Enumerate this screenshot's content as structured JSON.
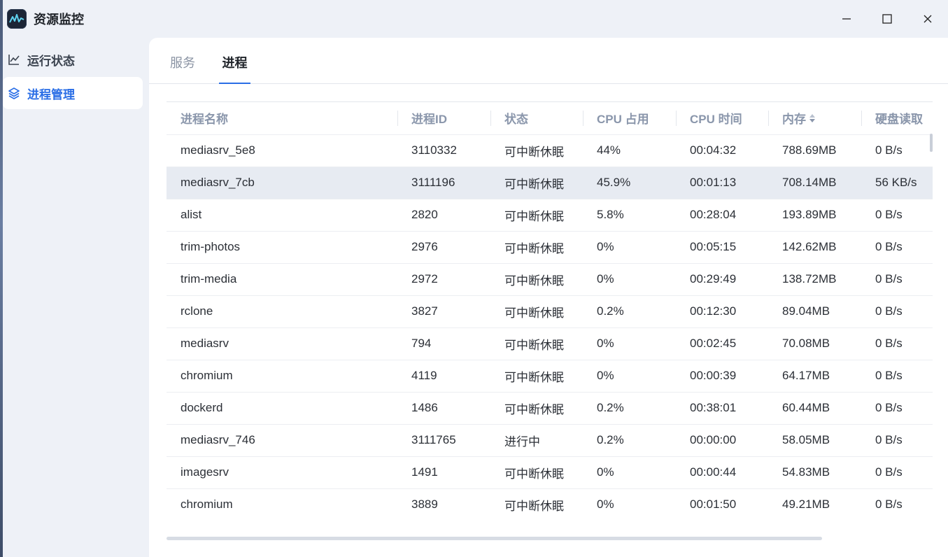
{
  "app": {
    "title": "资源监控"
  },
  "window_controls": [
    "minimize",
    "maximize",
    "close"
  ],
  "sidebar": {
    "items": [
      {
        "label": "运行状态",
        "icon": "line-chart-icon",
        "active": false
      },
      {
        "label": "进程管理",
        "icon": "layers-icon",
        "active": true
      }
    ]
  },
  "tabs": [
    {
      "label": "服务",
      "active": false
    },
    {
      "label": "进程",
      "active": true
    }
  ],
  "table": {
    "columns": [
      "进程名称",
      "进程ID",
      "状态",
      "CPU 占用",
      "CPU 时间",
      "内存",
      "硬盘读取"
    ],
    "sorted_column": "内存",
    "rows": [
      {
        "name": "mediasrv_5e8",
        "pid": "3110332",
        "state": "可中断休眠",
        "cpu": "44%",
        "cpu_time": "00:04:32",
        "mem": "788.69MB",
        "disk": "0 B/s"
      },
      {
        "name": "mediasrv_7cb",
        "pid": "3111196",
        "state": "可中断休眠",
        "cpu": "45.9%",
        "cpu_time": "00:01:13",
        "mem": "708.14MB",
        "disk": "56 KB/s",
        "selected": true
      },
      {
        "name": "alist",
        "pid": "2820",
        "state": "可中断休眠",
        "cpu": "5.8%",
        "cpu_time": "00:28:04",
        "mem": "193.89MB",
        "disk": "0 B/s"
      },
      {
        "name": "trim-photos",
        "pid": "2976",
        "state": "可中断休眠",
        "cpu": "0%",
        "cpu_time": "00:05:15",
        "mem": "142.62MB",
        "disk": "0 B/s"
      },
      {
        "name": "trim-media",
        "pid": "2972",
        "state": "可中断休眠",
        "cpu": "0%",
        "cpu_time": "00:29:49",
        "mem": "138.72MB",
        "disk": "0 B/s"
      },
      {
        "name": "rclone",
        "pid": "3827",
        "state": "可中断休眠",
        "cpu": "0.2%",
        "cpu_time": "00:12:30",
        "mem": "89.04MB",
        "disk": "0 B/s"
      },
      {
        "name": "mediasrv",
        "pid": "794",
        "state": "可中断休眠",
        "cpu": "0%",
        "cpu_time": "00:02:45",
        "mem": "70.08MB",
        "disk": "0 B/s"
      },
      {
        "name": "chromium",
        "pid": "4119",
        "state": "可中断休眠",
        "cpu": "0%",
        "cpu_time": "00:00:39",
        "mem": "64.17MB",
        "disk": "0 B/s"
      },
      {
        "name": "dockerd",
        "pid": "1486",
        "state": "可中断休眠",
        "cpu": "0.2%",
        "cpu_time": "00:38:01",
        "mem": "60.44MB",
        "disk": "0 B/s"
      },
      {
        "name": "mediasrv_746",
        "pid": "3111765",
        "state": "进行中",
        "cpu": "0.2%",
        "cpu_time": "00:00:00",
        "mem": "58.05MB",
        "disk": "0 B/s"
      },
      {
        "name": "imagesrv",
        "pid": "1491",
        "state": "可中断休眠",
        "cpu": "0%",
        "cpu_time": "00:00:44",
        "mem": "54.83MB",
        "disk": "0 B/s"
      },
      {
        "name": "chromium",
        "pid": "3889",
        "state": "可中断休眠",
        "cpu": "0%",
        "cpu_time": "00:01:50",
        "mem": "49.21MB",
        "disk": "0 B/s"
      }
    ]
  },
  "colors": {
    "accent": "#2a6ee6",
    "selected_row": "#e7ebf2",
    "header_text": "#8a96ab"
  }
}
